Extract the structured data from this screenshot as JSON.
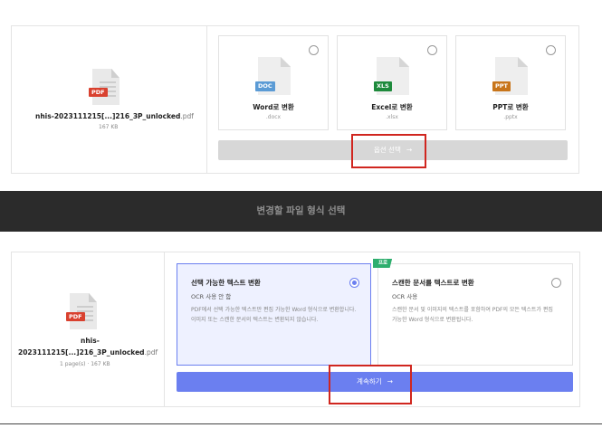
{
  "top_panel": {
    "file": {
      "type_tag": "PDF",
      "name_main": "nhis-2023111215[...]216_3P_unlocked",
      "name_ext": ".pdf",
      "size": "167 KB"
    },
    "options": [
      {
        "tag": "DOC",
        "tag_color": "#5b9bd5",
        "title": "Word로 변환",
        "ext": ".docx"
      },
      {
        "tag": "XLS",
        "tag_color": "#1e8a3c",
        "title": "Excel로 변환",
        "ext": ".xlsx"
      },
      {
        "tag": "PPT",
        "tag_color": "#c8751a",
        "title": "PPT로 변환",
        "ext": ".pptx"
      }
    ],
    "select_button": {
      "label": "옵션 선택",
      "arrow": "→"
    }
  },
  "banner": {
    "title": "변경할 파일 형식 선택"
  },
  "bottom_panel": {
    "file": {
      "type_tag": "PDF",
      "name_line1": "nhis-",
      "name_line2": "2023111215[...]216_3P_unlocked",
      "name_ext": ".pdf",
      "meta": "1 page(s) · 167 KB"
    },
    "ocr_options": [
      {
        "title": "선택 가능한 텍스트 변환",
        "subtitle": "OCR 사용 안 함",
        "description": "PDF에서 선택 가능한 텍스트만 편집 가능한 Word 형식으로 변환합니다. 이미지 또는 스캔한 문서의 텍스트는 변환되지 않습니다.",
        "selected": true
      },
      {
        "badge": "프로",
        "title": "스캔한 문서를 텍스트로 변환",
        "subtitle": "OCR 사용",
        "description": "스캔한 문서 및 이미지의 텍스트를 포함하여 PDF의 모든 텍스트가 편집 가능한 Word 형식으로 변환됩니다.",
        "selected": false
      }
    ],
    "continue_button": {
      "label": "계속하기",
      "arrow": "→"
    }
  },
  "colors": {
    "pdf_tag": "#d9412f",
    "primary": "#6b7ff0",
    "highlight": "#d0261f",
    "banner_bg": "#2b2b2b",
    "pro_badge": "#2eae6e"
  }
}
